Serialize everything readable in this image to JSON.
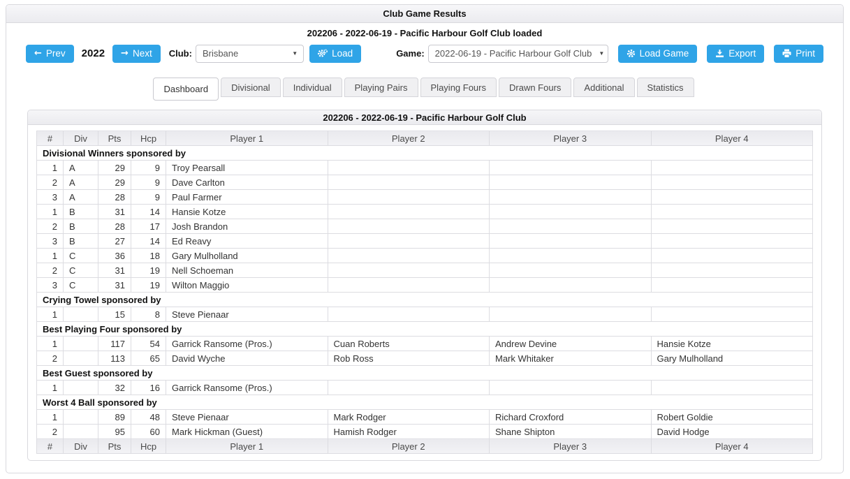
{
  "page": {
    "title": "Club Game Results",
    "subtitle": "202206 - 2022-06-19 - Pacific Harbour Golf Club loaded"
  },
  "controls": {
    "prev_label": "Prev",
    "year": "2022",
    "next_label": "Next",
    "club_label": "Club:",
    "club_value": "Brisbane",
    "load_label": "Load",
    "game_label": "Game:",
    "game_value": "2022-06-19 - Pacific Harbour Golf Club",
    "load_game_label": "Load Game",
    "export_label": "Export",
    "print_label": "Print",
    "caret_glyph": "▼",
    "prev_arrow": "←",
    "next_arrow": "→"
  },
  "tabs": [
    {
      "label": "Dashboard",
      "active": true
    },
    {
      "label": "Divisional",
      "active": false
    },
    {
      "label": "Individual",
      "active": false
    },
    {
      "label": "Playing Pairs",
      "active": false
    },
    {
      "label": "Playing Fours",
      "active": false
    },
    {
      "label": "Drawn Fours",
      "active": false
    },
    {
      "label": "Additional",
      "active": false
    },
    {
      "label": "Statistics",
      "active": false
    }
  ],
  "results": {
    "title": "202206 - 2022-06-19 - Pacific Harbour Golf Club",
    "columns": [
      "#",
      "Div",
      "Pts",
      "Hcp",
      "Player 1",
      "Player 2",
      "Player 3",
      "Player 4"
    ],
    "sections": [
      {
        "heading": "Divisional Winners sponsored by",
        "rows": [
          [
            "1",
            "A",
            "29",
            "9",
            "Troy Pearsall",
            "",
            "",
            ""
          ],
          [
            "2",
            "A",
            "29",
            "9",
            "Dave Carlton",
            "",
            "",
            ""
          ],
          [
            "3",
            "A",
            "28",
            "9",
            "Paul Farmer",
            "",
            "",
            ""
          ],
          [
            "1",
            "B",
            "31",
            "14",
            "Hansie Kotze",
            "",
            "",
            ""
          ],
          [
            "2",
            "B",
            "28",
            "17",
            "Josh Brandon",
            "",
            "",
            ""
          ],
          [
            "3",
            "B",
            "27",
            "14",
            "Ed Reavy",
            "",
            "",
            ""
          ],
          [
            "1",
            "C",
            "36",
            "18",
            "Gary Mulholland",
            "",
            "",
            ""
          ],
          [
            "2",
            "C",
            "31",
            "19",
            "Nell Schoeman",
            "",
            "",
            ""
          ],
          [
            "3",
            "C",
            "31",
            "19",
            "Wilton Maggio",
            "",
            "",
            ""
          ]
        ]
      },
      {
        "heading": "Crying Towel sponsored by",
        "rows": [
          [
            "1",
            "",
            "15",
            "8",
            "Steve Pienaar",
            "",
            "",
            ""
          ]
        ]
      },
      {
        "heading": "Best Playing Four sponsored by",
        "rows": [
          [
            "1",
            "",
            "117",
            "54",
            "Garrick Ransome (Pros.)",
            "Cuan Roberts",
            "Andrew Devine",
            "Hansie Kotze"
          ],
          [
            "2",
            "",
            "113",
            "65",
            "David Wyche",
            "Rob Ross",
            "Mark Whitaker",
            "Gary Mulholland"
          ]
        ]
      },
      {
        "heading": "Best Guest sponsored by",
        "rows": [
          [
            "1",
            "",
            "32",
            "16",
            "Garrick Ransome (Pros.)",
            "",
            "",
            ""
          ]
        ]
      },
      {
        "heading": "Worst 4 Ball sponsored by",
        "rows": [
          [
            "1",
            "",
            "89",
            "48",
            "Steve Pienaar",
            "Mark Rodger",
            "Richard Croxford",
            "Robert Goldie"
          ],
          [
            "2",
            "",
            "95",
            "60",
            "Mark Hickman (Guest)",
            "Hamish Rodger",
            "Shane Shipton",
            "David Hodge"
          ]
        ]
      }
    ]
  },
  "colors": {
    "accent": "#2fa4e7",
    "panel_border": "#d9d9de",
    "header_bg": "#ededf1"
  }
}
